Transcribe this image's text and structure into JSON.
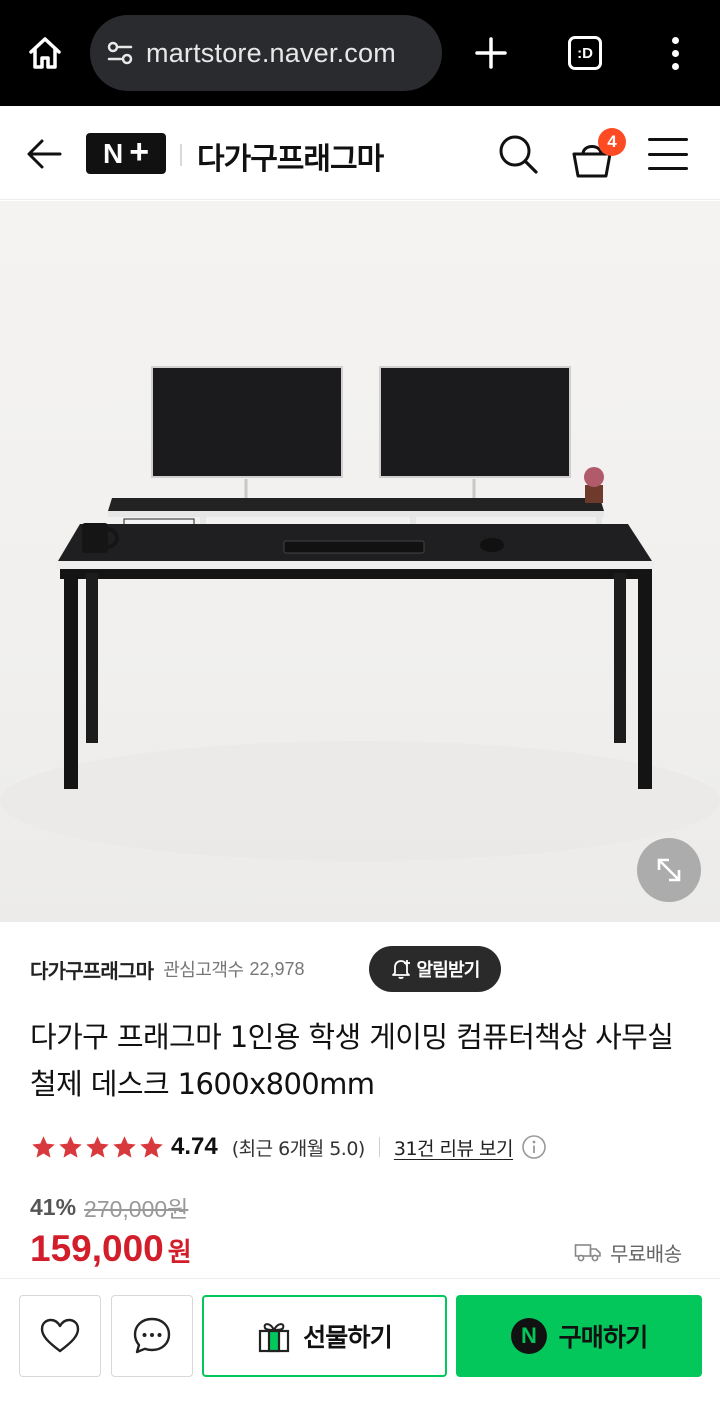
{
  "browser": {
    "url_text": "martstore.naver.com",
    "tab_label": ":D"
  },
  "header": {
    "logo_text": "N",
    "logo_plus": "+",
    "store_name": "다가구프래그마",
    "cart_count": "4"
  },
  "product": {
    "image_icons": [
      "desk-photo",
      "expand-icon"
    ]
  },
  "seller": {
    "name": "다가구프래그마",
    "followers_label": "관심고객수",
    "followers_count": "22,978",
    "alarm_label": "알림받기"
  },
  "title": "다가구 프래그마 1인용 학생 게이밍 컴퓨터책상 사무실 철제 데스크 1600x800mm",
  "rating": {
    "stars": 5,
    "value": "4.74",
    "recent": "(최근 6개월 5.0)",
    "review_link": "31건 리뷰 보기"
  },
  "pricing": {
    "discount_rate": "41%",
    "original_price": "270,000원",
    "sale_price": "159,000",
    "currency": "원",
    "shipping": "무료배송"
  },
  "actions": {
    "gift_label": "선물하기",
    "buy_label": "구매하기",
    "buy_badge": "N"
  },
  "colors": {
    "accent_green": "#03c75a",
    "price_red": "#d21e2b",
    "badge_orange": "#ff4b23",
    "star_red": "#d8393c"
  }
}
